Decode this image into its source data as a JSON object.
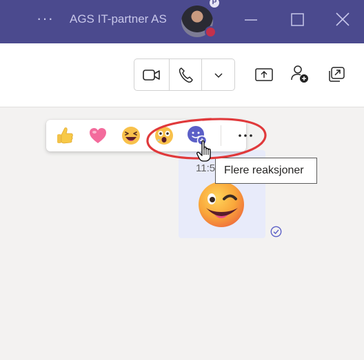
{
  "titlebar": {
    "more_label": "···",
    "title": "AGS IT-partner AS",
    "avatar_badge": "P"
  },
  "header": {
    "icons": [
      "video-icon",
      "phone-icon",
      "chevron-down-icon",
      "share-screen-icon",
      "add-people-icon",
      "pop-out-icon"
    ]
  },
  "reactions": [
    "like",
    "heart",
    "laugh",
    "surprised",
    "more-reactions",
    "more-options"
  ],
  "message": {
    "time": "11:5",
    "tooltip": "Flere reaksjoner",
    "emoji": "winking-face"
  },
  "colors": {
    "titlebar": "#4b4a8e",
    "accent": "#5b5fc7",
    "bubble": "#e8ebfa",
    "annotation": "#e0393b"
  }
}
